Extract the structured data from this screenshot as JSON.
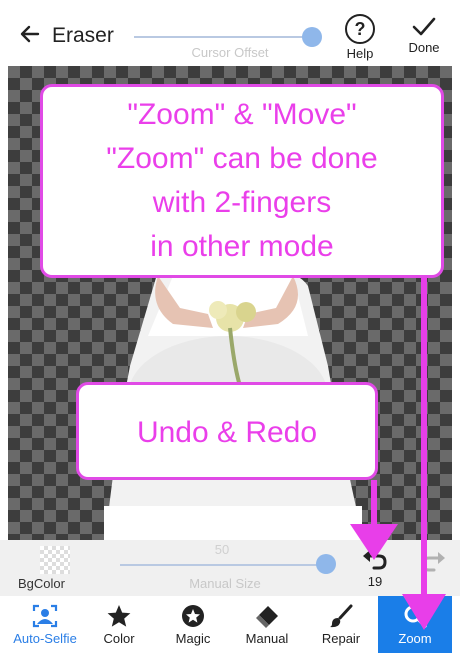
{
  "header": {
    "title": "Eraser",
    "slider_label": "Cursor Offset",
    "help_label": "Help",
    "done_label": "Done"
  },
  "annotations": {
    "zoom_lines": [
      "\"Zoom\" & \"Move\"",
      "\"Zoom\" can be done",
      "with 2-fingers",
      "in other mode"
    ],
    "undo_text": "Undo & Redo"
  },
  "controls": {
    "bgcolor_label": "BgColor",
    "size_value": "50",
    "size_label": "Manual Size",
    "undo_count": "19"
  },
  "toolbar": {
    "items": [
      {
        "label": "Auto-Selfie",
        "icon": "auto-selfie-icon"
      },
      {
        "label": "Color",
        "icon": "star-icon"
      },
      {
        "label": "Magic",
        "icon": "magic-star-icon"
      },
      {
        "label": "Manual",
        "icon": "eraser-icon"
      },
      {
        "label": "Repair",
        "icon": "brush-icon"
      },
      {
        "label": "Zoom",
        "icon": "search-icon"
      }
    ],
    "selected": "Zoom"
  },
  "colors": {
    "accent_blue": "#1a7ee8",
    "callout_magenta": "#e04ae6"
  }
}
